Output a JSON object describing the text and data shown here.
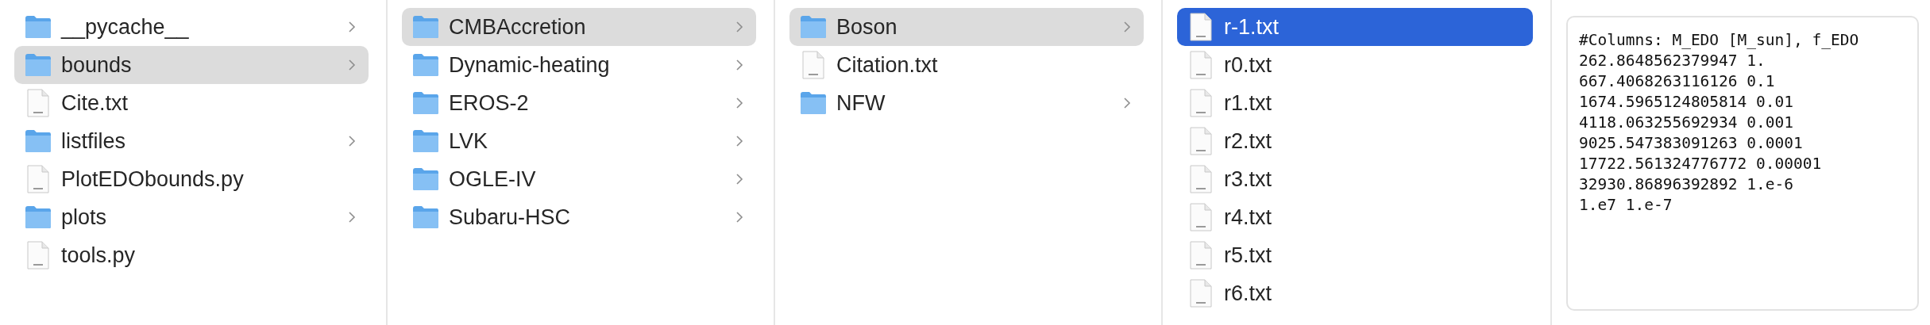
{
  "columns": [
    {
      "active": false,
      "items": [
        {
          "name": "__pycache__",
          "kind": "folder",
          "selected": false
        },
        {
          "name": "bounds",
          "kind": "folder",
          "selected": true
        },
        {
          "name": "Cite.txt",
          "kind": "file",
          "selected": false
        },
        {
          "name": "listfiles",
          "kind": "folder",
          "selected": false
        },
        {
          "name": "PlotEDObounds.py",
          "kind": "file",
          "selected": false
        },
        {
          "name": "plots",
          "kind": "folder",
          "selected": false
        },
        {
          "name": "tools.py",
          "kind": "file",
          "selected": false
        }
      ]
    },
    {
      "active": false,
      "items": [
        {
          "name": "CMBAccretion",
          "kind": "folder",
          "selected": true
        },
        {
          "name": "Dynamic-heating",
          "kind": "folder",
          "selected": false
        },
        {
          "name": "EROS-2",
          "kind": "folder",
          "selected": false
        },
        {
          "name": "LVK",
          "kind": "folder",
          "selected": false
        },
        {
          "name": "OGLE-IV",
          "kind": "folder",
          "selected": false
        },
        {
          "name": "Subaru-HSC",
          "kind": "folder",
          "selected": false
        }
      ]
    },
    {
      "active": false,
      "items": [
        {
          "name": "Boson",
          "kind": "folder",
          "selected": true
        },
        {
          "name": "Citation.txt",
          "kind": "file",
          "selected": false
        },
        {
          "name": "NFW",
          "kind": "folder",
          "selected": false
        }
      ]
    },
    {
      "active": true,
      "items": [
        {
          "name": "r-1.txt",
          "kind": "file",
          "selected": true
        },
        {
          "name": "r0.txt",
          "kind": "file",
          "selected": false
        },
        {
          "name": "r1.txt",
          "kind": "file",
          "selected": false
        },
        {
          "name": "r2.txt",
          "kind": "file",
          "selected": false
        },
        {
          "name": "r3.txt",
          "kind": "file",
          "selected": false
        },
        {
          "name": "r4.txt",
          "kind": "file",
          "selected": false
        },
        {
          "name": "r5.txt",
          "kind": "file",
          "selected": false
        },
        {
          "name": "r6.txt",
          "kind": "file",
          "selected": false
        }
      ]
    }
  ],
  "preview": {
    "lines": [
      "#Columns: M_EDO [M_sun], f_EDO",
      "262.8648562379947 1.",
      "667.4068263116126 0.1",
      "1674.5965124805814 0.01",
      "4118.063255692934 0.001",
      "9025.547383091263 0.0001",
      "17722.561324776772 0.00001",
      "32930.86896392892 1.e-6",
      "1.e7 1.e-7"
    ]
  }
}
